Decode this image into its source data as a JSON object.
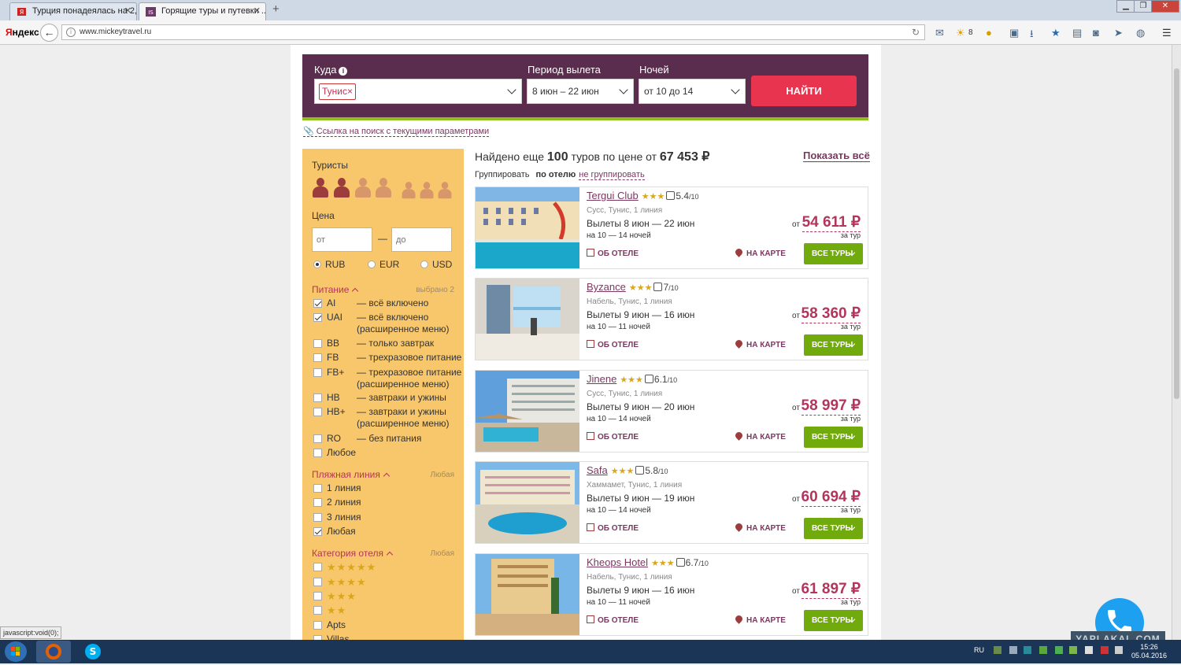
{
  "browser": {
    "tabs": [
      {
        "title": "Турция понадеялась на 2,...",
        "active": false
      },
      {
        "title": "Горящие туры и путевки ...",
        "active": true
      }
    ],
    "new_tab": "+",
    "yandex_logo_y": "Я",
    "yandex_logo_rest": "ндекс",
    "url": "www.mickeytravel.ru",
    "weather_count": "8",
    "status_text": "javascript:void(0);"
  },
  "search": {
    "where_label": "Куда",
    "where_chip": "Тунис",
    "where_chip_close": "×",
    "period_label": "Период вылета",
    "period_value": "8 июн – 22 июн",
    "nights_label": "Ночей",
    "nights_value": "от 10 до 14",
    "find_button": "НАЙТИ",
    "permalink": "Ссылка на поиск с текущими параметрами"
  },
  "filters": {
    "tourists_title": "Туристы",
    "price_title": "Цена",
    "price_from_placeholder": "от",
    "price_to_placeholder": "до",
    "price_dash": "—",
    "currencies": [
      {
        "label": "RUB",
        "checked": true
      },
      {
        "label": "EUR",
        "checked": false
      },
      {
        "label": "USD",
        "checked": false
      }
    ],
    "meal_title": "Питание",
    "meal_note": "выбрано 2",
    "meals": [
      {
        "code": "AI",
        "desc": "— всё включено",
        "checked": true
      },
      {
        "code": "UAI",
        "desc": "— всё включено (расширенное меню)",
        "checked": true
      },
      {
        "code": "BB",
        "desc": "— только завтрак",
        "checked": false
      },
      {
        "code": "FB",
        "desc": "— трехразовое питание",
        "checked": false
      },
      {
        "code": "FB+",
        "desc": "— трехразовое питание (расширенное меню)",
        "checked": false
      },
      {
        "code": "HB",
        "desc": "— завтраки и ужины",
        "checked": false
      },
      {
        "code": "HB+",
        "desc": "— завтраки и ужины (расширенное меню)",
        "checked": false
      },
      {
        "code": "RO",
        "desc": "— без питания",
        "checked": false
      },
      {
        "code": "Любое",
        "desc": "",
        "checked": false
      }
    ],
    "beach_title": "Пляжная линия",
    "beach_note": "Любая",
    "beach_lines": [
      {
        "label": "1 линия",
        "checked": false
      },
      {
        "label": "2 линия",
        "checked": false
      },
      {
        "label": "3 линия",
        "checked": false
      },
      {
        "label": "Любая",
        "checked": true
      }
    ],
    "category_title": "Категория отеля",
    "category_note": "Любая",
    "categories": [
      {
        "label": "★★★★★",
        "stars": 5
      },
      {
        "label": "★★★★",
        "stars": 4
      },
      {
        "label": "★★★",
        "stars": 3
      },
      {
        "label": "★★",
        "stars": 2
      },
      {
        "label": "Apts",
        "stars": 0
      },
      {
        "label": "Villas",
        "stars": 0
      }
    ]
  },
  "results": {
    "found_prefix": "Найдено еще",
    "found_count": "100",
    "found_mid": "туров по цене от",
    "found_price": "67 453 ₽",
    "show_all": "Показать всё",
    "group_label": "Группировать",
    "group_by_hotel": "по отелю",
    "group_none": "не группировать",
    "details_label": "ОБ ОТЕЛЕ",
    "map_label": "НА КАРТЕ",
    "all_tours_label": "ВСЕ ТУРЫ",
    "from_label": "от",
    "per_tour_label": "за тур",
    "hotels": [
      {
        "name": "Tergui Club",
        "stars": "★★★",
        "rating": "5.4",
        "rating_max": "/10",
        "location": "Сусс, Тунис, 1 линия",
        "departures": "Вылеты 8 июн — 22 июн",
        "nights": "на 10 — 14 ночей",
        "price": "54 611 ₽"
      },
      {
        "name": "Byzance",
        "stars": "★★★",
        "rating": "7",
        "rating_max": "/10",
        "location": "Набель, Тунис, 1 линия",
        "departures": "Вылеты 9 июн — 16 июн",
        "nights": "на 10 — 11 ночей",
        "price": "58 360 ₽"
      },
      {
        "name": "Jinene",
        "stars": "★★★",
        "rating": "6.1",
        "rating_max": "/10",
        "location": "Сусс, Тунис, 1 линия",
        "departures": "Вылеты 9 июн — 20 июн",
        "nights": "на 10 — 14 ночей",
        "price": "58 997 ₽"
      },
      {
        "name": "Safa",
        "stars": "★★★",
        "rating": "5.8",
        "rating_max": "/10",
        "location": "Хаммамет, Тунис, 1 линия",
        "departures": "Вылеты 9 июн — 19 июн",
        "nights": "на 10 — 14 ночей",
        "price": "60 694 ₽"
      },
      {
        "name": "Kheops Hotel",
        "stars": "★★★",
        "rating": "6.7",
        "rating_max": "/10",
        "location": "Набель, Тунис, 1 линия",
        "departures": "Вылеты 9 июн — 16 июн",
        "nights": "на 10 — 11 ночей",
        "price": "61 897 ₽"
      }
    ]
  },
  "taskbar": {
    "lang": "RU",
    "time": "15:26",
    "date": "05.04.2016"
  },
  "watermark": "YAPLAKAL.COM"
}
